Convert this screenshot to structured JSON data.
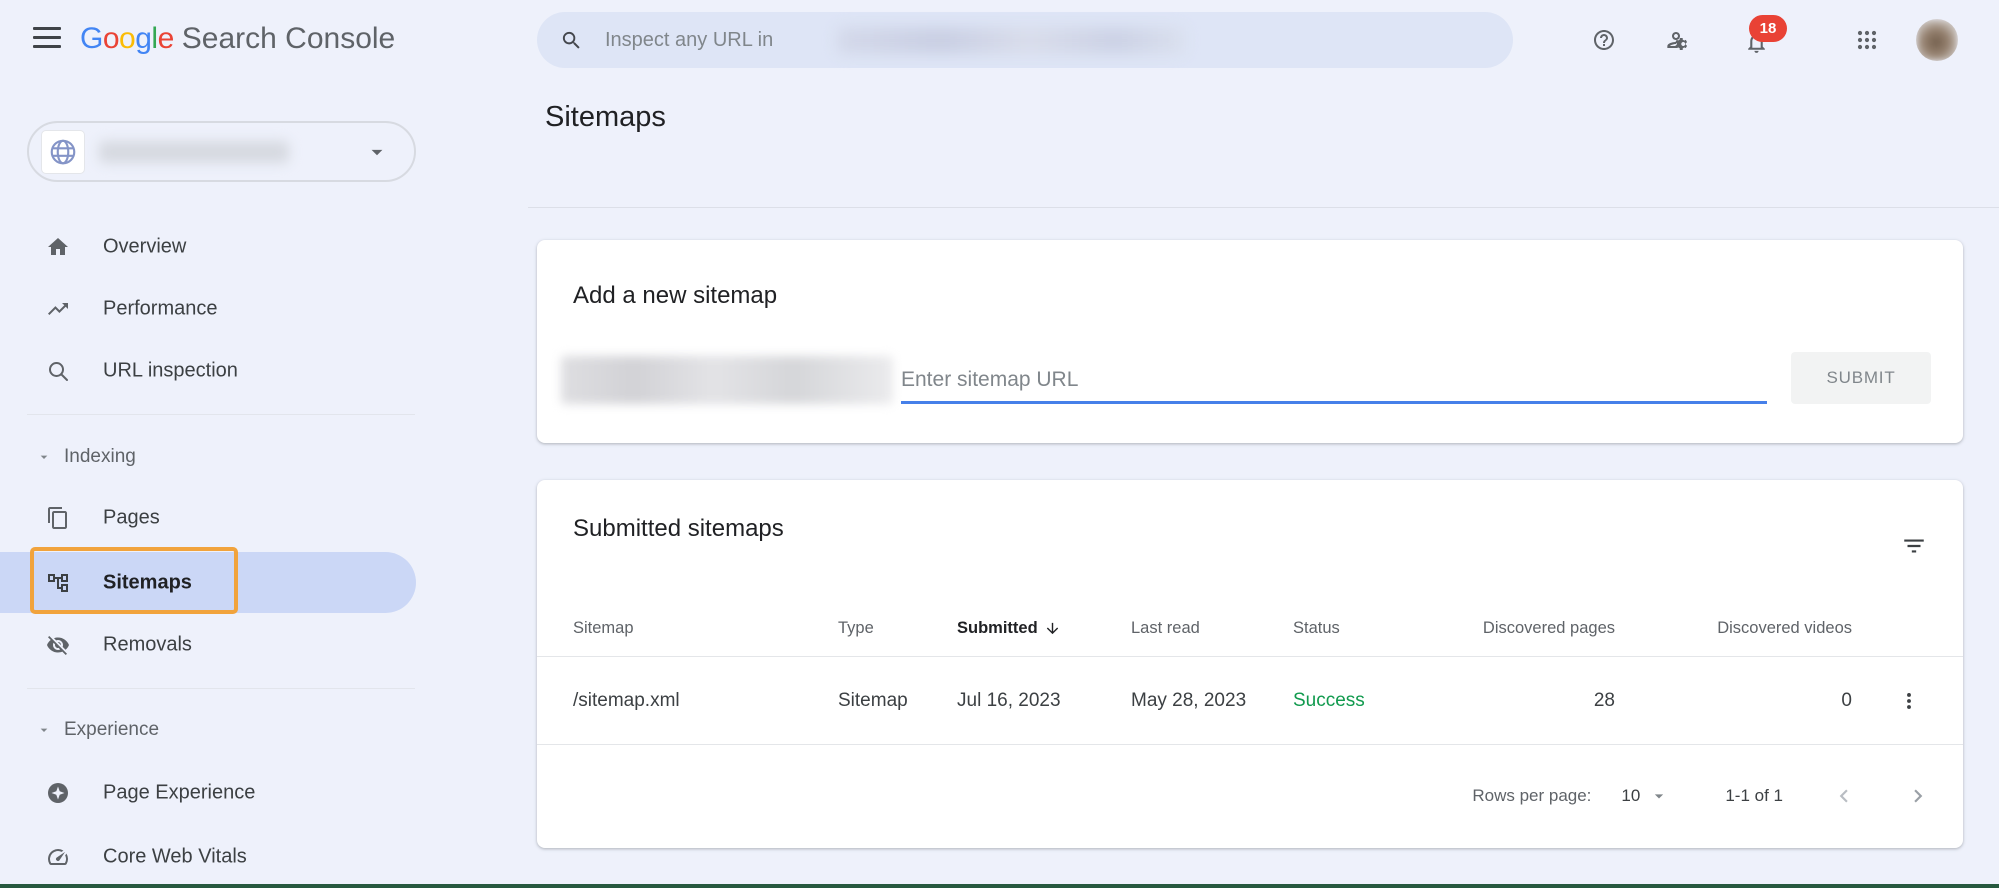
{
  "header": {
    "logo_letters": [
      "G",
      "o",
      "o",
      "g",
      "l",
      "e"
    ],
    "product_name": "Search Console",
    "search_placeholder": "Inspect any URL in",
    "notification_count": "18",
    "icons": [
      "hamburger-icon",
      "search-icon",
      "help-icon",
      "manage-account-icon",
      "notifications-bell-icon",
      "apps-grid-icon",
      "avatar"
    ]
  },
  "sidebar": {
    "property_selector": {
      "icon": "globe-favicon",
      "note": "property name redacted"
    },
    "nav": {
      "overview": "Overview",
      "performance": "Performance",
      "url_inspection": "URL inspection",
      "pages": "Pages",
      "sitemaps": "Sitemaps",
      "removals": "Removals",
      "page_experience": "Page Experience",
      "core_web_vitals": "Core Web Vitals"
    },
    "groups": {
      "indexing": "Indexing",
      "experience": "Experience"
    },
    "active_item": "Sitemaps"
  },
  "main": {
    "title": "Sitemaps",
    "add_card": {
      "title": "Add a new sitemap",
      "input_placeholder": "Enter sitemap URL",
      "submit_label": "SUBMIT"
    },
    "sitemaps_card": {
      "title": "Submitted sitemaps",
      "columns": [
        "Sitemap",
        "Type",
        "Submitted",
        "Last read",
        "Status",
        "Discovered pages",
        "Discovered videos"
      ],
      "sorted_column": "Submitted",
      "rows": [
        {
          "sitemap": "/sitemap.xml",
          "type": "Sitemap",
          "submitted": "Jul 16, 2023",
          "last_read": "May 28, 2023",
          "status": "Success",
          "discovered_pages": "28",
          "discovered_videos": "0"
        }
      ],
      "pagination": {
        "rows_per_page_label": "Rows per page:",
        "rows_per_page_value": "10",
        "range": "1-1 of 1"
      }
    }
  },
  "colors": {
    "page_background": "#eef1fb",
    "search_pill": "#dee5f6",
    "active_nav_pill": "#cbd7f6",
    "annotation_orange": "#f1a33c",
    "input_underline_blue": "#4680e9",
    "success_green": "#119a4e",
    "badge_red": "#e94235",
    "bottom_bar_green": "#27593f",
    "logo_blue": "#4285F4",
    "logo_red": "#EA4335",
    "logo_yellow": "#FBBC05",
    "logo_green": "#34A853"
  }
}
